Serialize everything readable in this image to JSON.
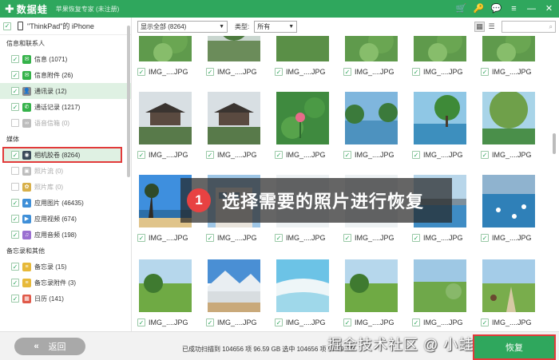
{
  "app": {
    "logo_symbol": "✚",
    "logo_text": "数据蛙",
    "subtitle": "苹果恢复专家 (未注册)",
    "brand_color": "#2fa75d",
    "title_icons": [
      "cart-icon",
      "key-icon",
      "chat-icon",
      "menu-icon",
      "minimize-icon",
      "close-icon"
    ],
    "title_glyphs": [
      "🛒",
      "🔑",
      "💬",
      "≡",
      "—",
      "✕"
    ]
  },
  "device": {
    "name": "\"ThinkPad\"的 iPhone"
  },
  "sidebar": {
    "sections": [
      {
        "title": "信息和联系人",
        "items": [
          {
            "label": "信息 (1071)",
            "icon": "message-icon",
            "glyph": "✉",
            "icon_color": "#35b24a",
            "checked": true,
            "dim": false,
            "selected": false,
            "highlighted": false
          },
          {
            "label": "信息附件 (26)",
            "icon": "attachment-icon",
            "glyph": "✉",
            "icon_color": "#35b24a",
            "checked": true,
            "dim": false,
            "selected": false,
            "highlighted": false
          },
          {
            "label": "通讯录 (12)",
            "icon": "contacts-icon",
            "glyph": "👤",
            "icon_color": "#8a8a8a",
            "checked": true,
            "dim": false,
            "selected": true,
            "highlighted": false
          },
          {
            "label": "通话记录 (1217)",
            "icon": "phone-icon",
            "glyph": "✆",
            "icon_color": "#35b24a",
            "checked": true,
            "dim": false,
            "selected": false,
            "highlighted": false
          },
          {
            "label": "语音信箱 (0)",
            "icon": "voicemail-icon",
            "glyph": "∞",
            "icon_color": "#bdbdbd",
            "checked": false,
            "dim": true,
            "selected": false,
            "highlighted": false
          }
        ]
      },
      {
        "title": "媒体",
        "items": [
          {
            "label": "相机胶卷 (8264)",
            "icon": "camera-icon",
            "glyph": "◉",
            "icon_color": "#3b4a5a",
            "checked": true,
            "dim": false,
            "selected": true,
            "highlighted": true
          },
          {
            "label": "照片流 (0)",
            "icon": "photo-stream-icon",
            "glyph": "▣",
            "icon_color": "#bdbdbd",
            "checked": false,
            "dim": true,
            "selected": false,
            "highlighted": false
          },
          {
            "label": "照片库 (0)",
            "icon": "photo-library-icon",
            "glyph": "✿",
            "icon_color": "#d8b04a",
            "checked": false,
            "dim": true,
            "selected": false,
            "highlighted": false
          },
          {
            "label": "应用图片 (46435)",
            "icon": "app-photo-icon",
            "glyph": "▲",
            "icon_color": "#3f8fd8",
            "checked": true,
            "dim": false,
            "selected": false,
            "highlighted": false
          },
          {
            "label": "应用视频 (674)",
            "icon": "app-video-icon",
            "glyph": "▶",
            "icon_color": "#3f8fd8",
            "checked": true,
            "dim": false,
            "selected": false,
            "highlighted": false
          },
          {
            "label": "应用音频 (198)",
            "icon": "app-audio-icon",
            "glyph": "♫",
            "icon_color": "#9b6fd1",
            "checked": true,
            "dim": false,
            "selected": false,
            "highlighted": false
          }
        ]
      },
      {
        "title": "备忘录和其他",
        "items": [
          {
            "label": "备忘录 (15)",
            "icon": "notes-icon",
            "glyph": "≡",
            "icon_color": "#e7b93a",
            "checked": true,
            "dim": false,
            "selected": false,
            "highlighted": false
          },
          {
            "label": "备忘录附件 (3)",
            "icon": "notes-attachment-icon",
            "glyph": "≡",
            "icon_color": "#e7b93a",
            "checked": true,
            "dim": false,
            "selected": false,
            "highlighted": false
          },
          {
            "label": "日历 (141)",
            "icon": "calendar-icon",
            "glyph": "▦",
            "icon_color": "#e05a4a",
            "checked": true,
            "dim": false,
            "selected": false,
            "highlighted": false
          }
        ]
      }
    ]
  },
  "toolbar": {
    "filter_value": "显示全部 (8264)",
    "type_label": "类型:",
    "type_value": "所有",
    "grid_view_glyph": "▦",
    "list_view_glyph": "☰",
    "search_placeholder": "",
    "search_glyph": "⌕"
  },
  "grid": {
    "file_label": "IMG_....JPG",
    "rows": [
      {
        "partial": true,
        "scenes": [
          "lotus",
          "tree",
          "grass",
          "lotus",
          "lotus",
          "lotus"
        ]
      },
      {
        "partial": false,
        "scenes": [
          "pavilion",
          "pavilion",
          "lotus-flower",
          "lake",
          "lake-tree",
          "tree-lake"
        ]
      },
      {
        "partial": false,
        "scenes": [
          "beach",
          "building",
          "",
          "",
          "city-sea",
          "swans"
        ]
      },
      {
        "partial": false,
        "scenes": [
          "meadow",
          "mountain-lake",
          "terraces",
          "meadow",
          "field",
          "village"
        ]
      }
    ]
  },
  "overlay": {
    "step": "1",
    "text": "选择需要的照片进行恢复"
  },
  "bottom": {
    "back_glyph": "«",
    "back_label": "返回",
    "status": "已成功扫描到 104656 项 96.59 GB   选中 104656 项 96.59 GB",
    "watermark": "掘金技术社区 @ 小蛙说数码",
    "recover_label": "恢复"
  }
}
